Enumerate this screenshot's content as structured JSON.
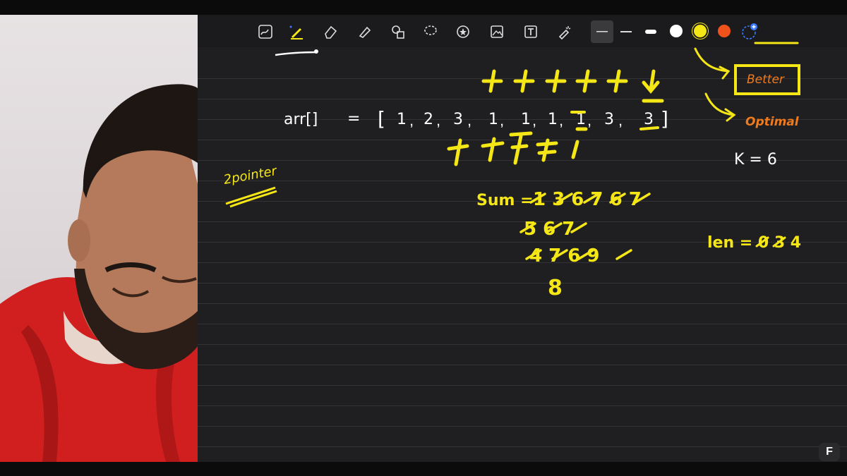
{
  "toolbar": {
    "tools": [
      {
        "name": "scribble-tool-icon"
      },
      {
        "name": "pen-tool-icon"
      },
      {
        "name": "eraser-tool-icon"
      },
      {
        "name": "highlighter-tool-icon"
      },
      {
        "name": "shapes-tool-icon"
      },
      {
        "name": "lasso-tool-icon"
      },
      {
        "name": "sticker-tool-icon"
      },
      {
        "name": "image-tool-icon"
      },
      {
        "name": "text-tool-icon"
      },
      {
        "name": "laser-pointer-tool-icon"
      }
    ],
    "colors": [
      "#ffffff",
      "#f5e616",
      "#f0521c"
    ],
    "ink_yellow": "#f5e616",
    "ink_orange": "#f07a1c"
  },
  "notes": {
    "arr_label": "arr[]",
    "equals": "=",
    "array": [
      "1",
      "2",
      "3",
      "1",
      "1",
      "1",
      "1",
      "3",
      "3"
    ],
    "better": "Better",
    "optimal": "Optimal",
    "k": "K = 6",
    "two_pointer": "2pointer",
    "sum_label": "Sum =",
    "sum_row1": "1 3 6 7 6 7",
    "sum_row2": "5 6 7",
    "sum_row3": "4 7 6 9",
    "sum_row4": "8",
    "len": "len = 0 3 4"
  },
  "brand": {
    "logo": "F"
  }
}
